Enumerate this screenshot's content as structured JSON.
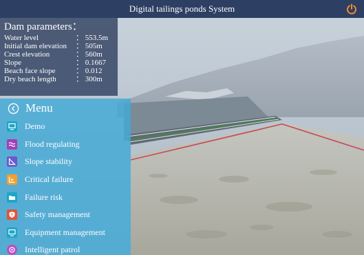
{
  "app": {
    "title": "Digital tailings ponds System"
  },
  "dam_parameters": {
    "title": "Dam parameters：",
    "rows": [
      {
        "label": "Water level",
        "value": "： 553.5m"
      },
      {
        "label": "Initial dam elevation",
        "value": "： 505m"
      },
      {
        "label": "Crest elevation",
        "value": "： 560m"
      },
      {
        "label": "Slope",
        "value": "： 0.1667"
      },
      {
        "label": "Beach face slope",
        "value": "： 0.012"
      },
      {
        "label": "Dry beach length",
        "value": "： 300m"
      }
    ]
  },
  "menu": {
    "title": "Menu",
    "items": [
      {
        "label": "Demo",
        "icon": "monitor-icon",
        "color": "#1aa7c9"
      },
      {
        "label": "Flood regulating",
        "icon": "wave-icon",
        "color": "#a23fb8"
      },
      {
        "label": "Slope stability",
        "icon": "slope-icon",
        "color": "#6a5acd"
      },
      {
        "label": "Critical failure",
        "icon": "chart-icon",
        "color": "#f0a030"
      },
      {
        "label": "Failure risk",
        "icon": "folder-icon",
        "color": "#1aa7c9"
      },
      {
        "label": "Safety management",
        "icon": "shield-icon",
        "color": "#e2533a"
      },
      {
        "label": "Equipment management",
        "icon": "monitor-icon",
        "color": "#1aa7c9"
      },
      {
        "label": "Intelligent patrol",
        "icon": "patrol-icon",
        "color": "#b84fc5"
      }
    ]
  },
  "colors": {
    "titlebar": "#2d3f63",
    "power": "#f08a30",
    "menu_bg": "#42aad7",
    "params_bg": "#41506e"
  }
}
